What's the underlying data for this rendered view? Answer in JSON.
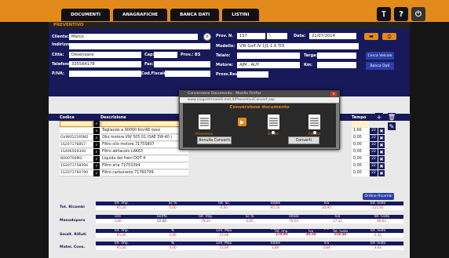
{
  "menu": [
    "DOCUMENTI",
    "ANAGRAFICHE",
    "BANCA DATI",
    "LISTINI"
  ],
  "toolbar": {
    "tools_icon": "Ⲧ",
    "help_icon": "?",
    "power_icon": "⏻"
  },
  "section_title": "PREVENTIVO",
  "form": {
    "cliente_label": "Cliente:",
    "cliente_value": "Marco",
    "indirizzo_label": "Indirizzo:",
    "citta_label": "Città:",
    "citta_value": "Desenzano",
    "cap_label": "Cap:",
    "prov_label": "Prov.: BS",
    "telefono_label": "Telefono:",
    "telefono_value": "335564178",
    "fax_label": "Fax:",
    "piva_label": "P.IVA:",
    "codfiscale_label": "Cod.Fiscale:",
    "provn_label": "Prov. N.",
    "provn_value": "157",
    "provn_suffix": "\\",
    "data_label": "Data:",
    "data_value": "21/07/2014",
    "modello_label": "Modello:",
    "modello_value": "VW Golf IV 1J1  1.9 TDI",
    "telaio_label": "Telaio:",
    "targa_label": "Targa:",
    "motore_label": "Motore:",
    "motore_value": "AJM ; AUY",
    "km_label": "Km:",
    "prossrev_label": "Pross.Rev.:",
    "cerca_veicolo": "Cerca Veicolo",
    "banca_dati": "Banca Dati"
  },
  "table": {
    "codice_header": "Codice",
    "descrizione_header": "Descrizione",
    "tempo_header": "Tempo",
    "rows": [
      {
        "code": "",
        "desc": "",
        "tempo": "",
        "qty": ""
      },
      {
        "code": "",
        "desc": "Tagliando a 90000 Km/48 mesi",
        "tempo": "1,60",
        "qty": "22"
      },
      {
        "code": "GVW052195M2",
        "desc": "Olio motore VW 505.01 (SAE 5W-40 )",
        "tempo": "0,00",
        "qty": "22"
      },
      {
        "code": "1S2071768S7",
        "desc": "Filtro olio motore 7175S807",
        "tempo": "0,00",
        "qty": "22"
      },
      {
        "code": "1S4065S9340",
        "desc": "Filtro abitacolo LAK63",
        "tempo": "0,00",
        "qty": "22"
      },
      {
        "code": "B000T00M3",
        "desc": "Liquido dei freni DOT 4",
        "tempo": "0,00",
        "qty": "22"
      },
      {
        "code": "1S2071758394",
        "desc": "Filtro aria 7175S394",
        "tempo": "0,00",
        "qty": "22"
      },
      {
        "code": "1S2071760799",
        "desc": "Filtro carburante 71760799",
        "tempo": "0,00",
        "qty": "22"
      }
    ],
    "ordine_ricambi": "Ordine Ricambi"
  },
  "dialog": {
    "title": "Conversione Documento - Mozilla Firefox",
    "url": "www.magnetimarelli-met.it/Preventivi/Convert.asp",
    "heading": "Conversione documento",
    "doc_labels": [
      "Preventivo",
      "Ordine",
      "Fattura"
    ],
    "annulla": "Annulla Converti",
    "converti": "Converti"
  },
  "totals": {
    "ricambi": {
      "label": "Tot. Ricambi",
      "headers": [
        "Tot. Imp.",
        "Sc.%",
        "Tot. Sc.",
        "Totale",
        "Iva",
        "Tot. Ivato"
      ],
      "values": [
        "95,20",
        "0,00",
        "0,00",
        "95,20",
        "20,95",
        "115,92"
      ]
    },
    "manodopera": {
      "label": "Manodopera",
      "headers": [
        "Ore",
        "Tariffa",
        "Tot. Imp.",
        "Sc.%",
        "Totale",
        "Iva",
        "Tot. Ivato"
      ],
      "values": [
        "3,60",
        "22,00",
        "79,20",
        "0,00",
        "79,20",
        "17,42",
        "96,62"
      ]
    },
    "smalt": {
      "label": "Smalt. Rifiuti",
      "headers": [
        "Tot. Imp.",
        "%",
        "Lim. Max",
        "Totale",
        "Iva",
        "Tot. Ivato"
      ],
      "values": [
        "95,00",
        "2,00",
        "15,00",
        "1,90",
        "0,42",
        "2,32"
      ]
    },
    "mater": {
      "label": "Mater. Cons.",
      "headers": [
        "Tot. Imp.",
        "%",
        "Lim. Max",
        "Totale",
        "Iva",
        "Tot. Ivato"
      ],
      "values": [
        "95,00",
        "4,00",
        "15,00",
        "3,80",
        "0,84",
        "4,64"
      ]
    },
    "grand": {
      "headers": [
        "Tot. Imp.",
        "Iva",
        "Tot. Ivato"
      ],
      "values": [
        "179,90",
        "39,58",
        "219,48"
      ]
    }
  }
}
